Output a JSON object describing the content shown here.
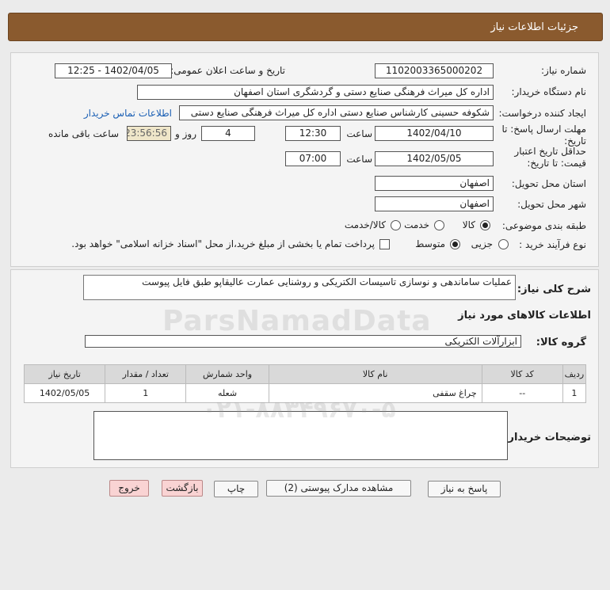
{
  "header": {
    "title": "جزئیات اطلاعات نیاز"
  },
  "fields": {
    "need_number_label": "شماره نیاز:",
    "need_number": "1102003365000202",
    "announce_label": "تاریخ و ساعت اعلان عمومی:",
    "announce_value": "1402/04/05 - 12:25",
    "buyer_org_label": "نام دستگاه خریدار:",
    "buyer_org": "اداره کل میراث فرهنگی  صنایع دستی و گردشگری استان اصفهان",
    "requester_label": "ایجاد کننده درخواست:",
    "requester": "شکوفه حسینی کارشناس صنایع دستی اداره کل میراث فرهنگی  صنایع دستی",
    "contact_link": "اطلاعات تماس خریدار",
    "deadline_label": "مهلت ارسال پاسخ: تا تاریخ:",
    "deadline_date": "1402/04/10",
    "time_label": "ساعت",
    "deadline_time": "12:30",
    "days_value": "4",
    "days_label": "روز و",
    "remaining_time": "23:56:56",
    "remaining_label": "ساعت باقی مانده",
    "validity_label_1": "حداقل تاریخ اعتبار",
    "validity_label_2": "قیمت: تا تاریخ:",
    "validity_date": "1402/05/05",
    "validity_time_label": "ساعت",
    "validity_time": "07:00",
    "province_label": "استان محل تحویل:",
    "province": "اصفهان",
    "city_label": "شهر محل تحویل:",
    "city": "اصفهان",
    "category_label": "طبقه بندی موضوعی:",
    "category_options": [
      "کالا",
      "خدمت",
      "کالا/خدمت"
    ],
    "category_selected": "کالا",
    "process_label": "نوع فرآیند خرید :",
    "process_options": [
      "جزیی",
      "متوسط"
    ],
    "process_selected": "متوسط",
    "payment_note": "پرداخت تمام یا بخشی از مبلغ خرید،از محل \"اسناد خزانه اسلامی\" خواهد بود."
  },
  "description": {
    "label": "شرح کلی نیاز:",
    "value": "عملیات ساماندهی و نوسازی تاسیسات الکتریکی و روشنایی عمارت عالیقاپو طبق فایل پیوست"
  },
  "goods": {
    "section_title": "اطلاعات کالاهای مورد نیاز",
    "group_label": "گروه کالا:",
    "group_value": "ابزارآلات الکتریکی",
    "columns": [
      "ردیف",
      "کد کالا",
      "نام کالا",
      "واحد شمارش",
      "تعداد / مقدار",
      "تاریخ نیاز"
    ],
    "rows": [
      [
        "1",
        "--",
        "چراغ سقفی",
        "شعله",
        "1",
        "1402/05/05"
      ]
    ]
  },
  "buyer_notes": {
    "label": "توضیحات خریدار:",
    "value": ""
  },
  "buttons": {
    "reply": "پاسخ به نیاز",
    "attachments": "مشاهده مدارک پیوستی (2)",
    "print": "چاپ",
    "back": "بازگشت",
    "exit": "خروج"
  },
  "watermark": {
    "brand": "ParsNamadData",
    "phone": "۰۲۱-۸۸۳۴۹۶۷۰-۵"
  }
}
